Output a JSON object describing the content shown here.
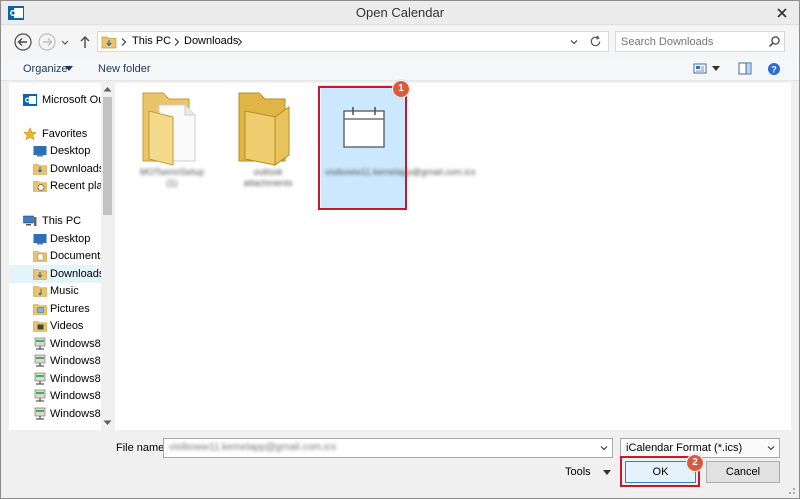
{
  "window": {
    "title": "Open Calendar"
  },
  "address": {
    "crumbs": [
      "This PC",
      "Downloads"
    ],
    "search_placeholder": "Search Downloads"
  },
  "toolbar": {
    "organize": "Organize",
    "new_folder": "New folder"
  },
  "nav": {
    "items": [
      {
        "label": "Microsoft Ou",
        "icon": "outlook-icon"
      },
      {
        "label": "Favorites",
        "icon": "star-icon"
      },
      {
        "label": "Desktop",
        "icon": "desktop-icon"
      },
      {
        "label": "Downloads",
        "icon": "downloads-folder-icon"
      },
      {
        "label": "Recent plac",
        "icon": "recent-places-icon"
      },
      {
        "label": "This PC",
        "icon": "computer-icon"
      },
      {
        "label": "Desktop",
        "icon": "desktop-icon"
      },
      {
        "label": "Documents",
        "icon": "documents-icon"
      },
      {
        "label": "Downloads",
        "icon": "downloads-folder-icon"
      },
      {
        "label": "Music",
        "icon": "music-icon"
      },
      {
        "label": "Pictures",
        "icon": "pictures-icon"
      },
      {
        "label": "Videos",
        "icon": "videos-icon"
      },
      {
        "label": "Windows8 (",
        "icon": "network-drive-icon"
      },
      {
        "label": "Windows8 (",
        "icon": "network-drive-icon"
      },
      {
        "label": "Windows8 (",
        "icon": "network-drive-icon"
      },
      {
        "label": "Windows8 (",
        "icon": "network-drive-icon"
      },
      {
        "label": "Windows8 (",
        "icon": "network-drive-icon"
      }
    ]
  },
  "files": [
    {
      "name": "MOTsemriSetup (1)",
      "type": "folder"
    },
    {
      "name": "outlook attachments",
      "type": "folder"
    },
    {
      "name": "visiboww11.kemelapp@gmail.com.ics",
      "type": "calendar"
    }
  ],
  "badges": {
    "one": "1",
    "two": "2"
  },
  "bottom": {
    "file_name_label": "File name:",
    "file_name_value": "visiboww11.kemelapp@gmail.com.ics",
    "file_type": "iCalendar Format (*.ics)",
    "tools": "Tools",
    "ok": "OK",
    "cancel": "Cancel"
  },
  "colors": {
    "highlight": "#c9182c",
    "badge": "#d95b3d",
    "selection": "#cce8ff"
  }
}
